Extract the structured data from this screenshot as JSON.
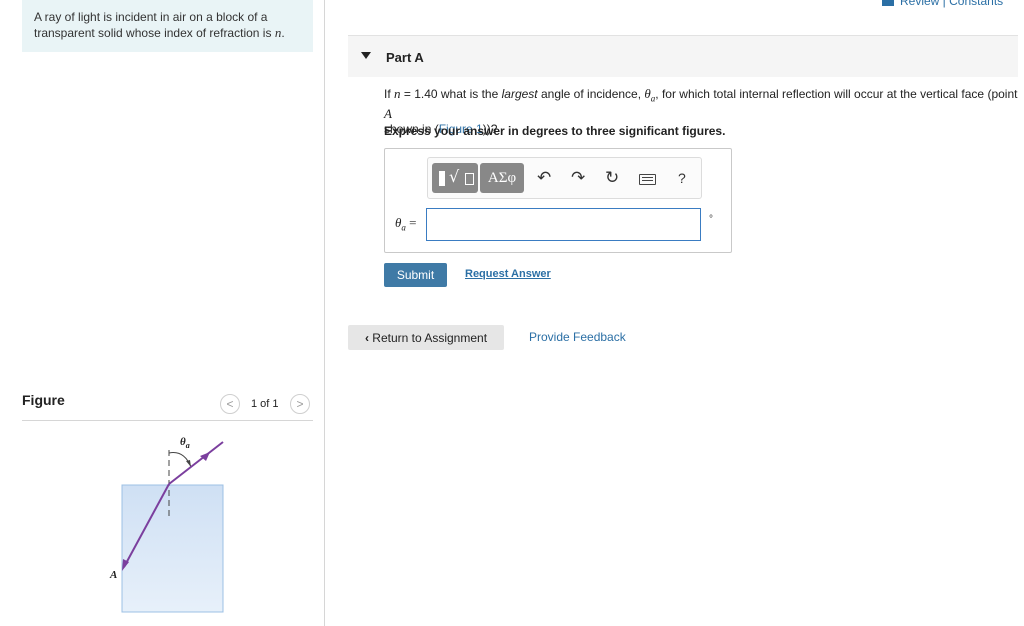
{
  "problem": {
    "text": "A ray of light is incident in air on a block of a transparent solid whose index of refraction is",
    "var": "n",
    "end": "."
  },
  "header": {
    "review_link": "Review | Constants"
  },
  "part": {
    "label": "Part A"
  },
  "question": {
    "p1": "If",
    "n_var": "n",
    "p2": "= 1.40 what is the",
    "largest": "largest",
    "p3": "angle of incidence,",
    "theta": "θ",
    "a_sub": "a",
    "p4": ", for which total internal reflection will occur at the vertical face (point",
    "A": "A",
    "p5": "shown in (",
    "fig_link": "Figure 1",
    "p6": "))?"
  },
  "instructions": "Express your answer in degrees to three significant figures.",
  "toolbar": {
    "templates_icon": "templates-icon",
    "greek_label": "ΑΣφ",
    "undo_icon": "↶",
    "redo_icon": "↷",
    "reset_icon": "↻",
    "help_label": "?"
  },
  "answer": {
    "var_theta": "θ",
    "var_sub": "a",
    "equals": "=",
    "value": "",
    "unit": "°"
  },
  "buttons": {
    "submit": "Submit",
    "request_answer": "Request Answer",
    "return": "Return to Assignment",
    "feedback": "Provide Feedback"
  },
  "figure": {
    "heading": "Figure",
    "counter": "1 of 1",
    "prev": "<",
    "next": ">",
    "theta_label": "θ",
    "theta_sub": "a",
    "point_label": "A"
  },
  "colors": {
    "link": "#2b6fa5",
    "submit_bg": "#3f7aa6",
    "ray": "#7b3f9e",
    "block_fill": "#dbe9f7",
    "block_stroke": "#9cc0e4",
    "problem_bg": "#e9f4f6"
  }
}
